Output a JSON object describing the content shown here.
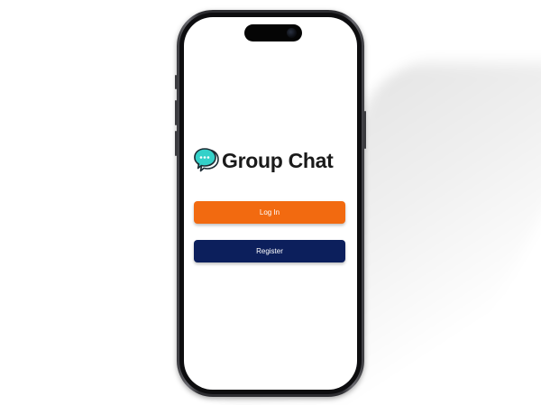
{
  "app": {
    "title": "Group Chat",
    "logo_icon": "chat-bubbles-icon"
  },
  "actions": {
    "login_label": "Log In",
    "register_label": "Register"
  },
  "colors": {
    "login_button": "#f26a10",
    "register_button": "#0c1f5c",
    "logo_bubble": "#34d1c9",
    "title_text": "#1a1a1a"
  }
}
